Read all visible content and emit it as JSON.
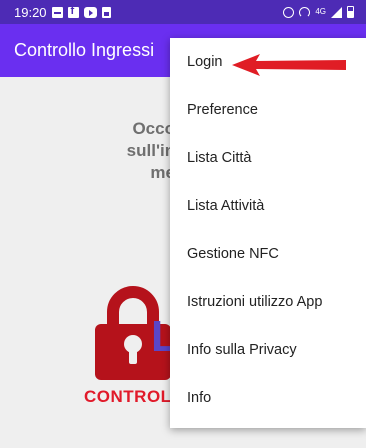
{
  "status_bar": {
    "time": "19:20",
    "left_icons": [
      "notification-icon",
      "facebook-icon",
      "youtube-icon",
      "document-icon"
    ],
    "right_icons": [
      "alarm-icon",
      "hotspot-icon",
      "data-arrows-icon",
      "signal-icon",
      "battery-icon"
    ],
    "data_label": "4G"
  },
  "app_bar": {
    "title": "Controllo Ingressi"
  },
  "main": {
    "instruction_lines": [
      "Occorre fare",
      "sull'immagine",
      "menù in"
    ],
    "logo_letter": "L",
    "logo_text": "CONTROL"
  },
  "menu": {
    "items": [
      {
        "label": "Login"
      },
      {
        "label": "Preference"
      },
      {
        "label": "Lista Città"
      },
      {
        "label": "Lista Attività"
      },
      {
        "label": "Gestione NFC"
      },
      {
        "label": "Istruzioni utilizzo App"
      },
      {
        "label": "Info sulla Privacy"
      },
      {
        "label": "Info"
      }
    ]
  },
  "colors": {
    "status_bar": "#4d2bb5",
    "app_bar": "#6a2ff0",
    "arrow": "#e01d25",
    "logo_red": "#b5121b",
    "logo_blue": "#5a46c8"
  }
}
